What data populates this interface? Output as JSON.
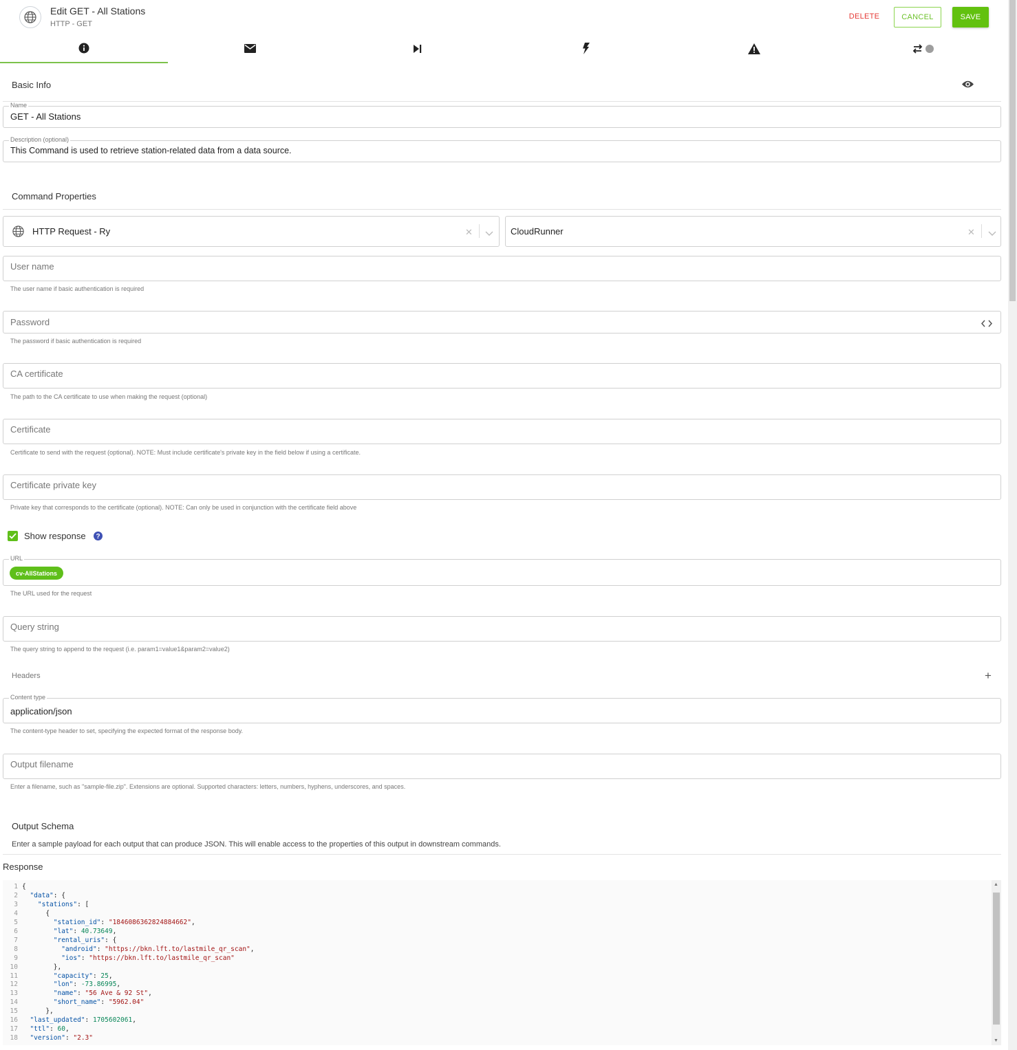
{
  "header": {
    "title": "Edit GET - All Stations",
    "subtitle": "HTTP - GET",
    "icon": "globe-icon",
    "delete_label": "DELETE",
    "cancel_label": "CANCEL",
    "save_label": "SAVE"
  },
  "tabs": [
    {
      "icon": "info-icon",
      "active": true
    },
    {
      "icon": "envelope-icon"
    },
    {
      "icon": "skip-next-icon"
    },
    {
      "icon": "bolt-icon"
    },
    {
      "icon": "warning-icon"
    },
    {
      "icon": "retry-toggle-icon"
    }
  ],
  "basic_info": {
    "title": "Basic Info",
    "name_legend": "Name",
    "name_value": "GET - All Stations",
    "description_legend": "Description (optional)",
    "description_value": "This Command is used to retrieve station-related data from a data source."
  },
  "command_properties": {
    "title": "Command Properties",
    "connector": "HTTP Request - Ry",
    "runner": "CloudRunner",
    "username_placeholder": "User name",
    "username_help": "The user name if basic authentication is required",
    "password_placeholder": "Password",
    "password_help": "The password if basic authentication is required",
    "ca_placeholder": "CA certificate",
    "ca_help": "The path to the CA certificate to use when making the request (optional)",
    "cert_placeholder": "Certificate",
    "cert_help": "Certificate to send with the request (optional). NOTE: Must include certificate's private key in the field below if using a certificate.",
    "key_placeholder": "Certificate private key",
    "key_help": "Private key that corresponds to the certificate (optional). NOTE: Can only be used in conjunction with the certificate field above",
    "show_response_label": "Show response",
    "show_response_checked": true,
    "url_legend": "URL",
    "url_chip": "cv-AllStations",
    "url_help": "The URL used for the request",
    "query_placeholder": "Query string",
    "query_help": "The query string to append to the request (i.e. param1=value1&param2=value2)",
    "headers_label": "Headers",
    "content_type_legend": "Content type",
    "content_type_value": "application/json",
    "content_type_help": "The content-type header to set, specifying the expected format of the response body.",
    "output_filename_placeholder": "Output filename",
    "output_filename_help": "Enter a filename, such as \"sample-file.zip\". Extensions are optional. Supported characters: letters, numbers, hyphens, underscores, and spaces."
  },
  "output_schema": {
    "title": "Output Schema",
    "description": "Enter a sample payload for each output that can produce JSON. This will enable access to the properties of this output in downstream commands.",
    "response_label": "Response",
    "line_numbers": [
      "1",
      "2",
      "3",
      "4",
      "5",
      "6",
      "7",
      "8",
      "9",
      "10",
      "11",
      "12",
      "13",
      "14",
      "15",
      "16",
      "17",
      "18"
    ],
    "code_lines": [
      "{",
      "  \"data\": {",
      "    \"stations\": [",
      "      {",
      "        \"station_id\": \"1846086362824884662\",",
      "        \"lat\": 40.73649,",
      "        \"rental_uris\": {",
      "          \"android\": \"https://bkn.lft.to/lastmile_qr_scan\",",
      "          \"ios\": \"https://bkn.lft.to/lastmile_qr_scan\"",
      "        },",
      "        \"capacity\": 25,",
      "        \"lon\": -73.86995,",
      "        \"name\": \"56 Ave & 92 St\",",
      "        \"short_name\": \"5962.04\"",
      "      },",
      "  \"last_updated\": 1705602061,",
      "  \"ttl\": 60,",
      "  \"version\": \"2.3\""
    ]
  }
}
